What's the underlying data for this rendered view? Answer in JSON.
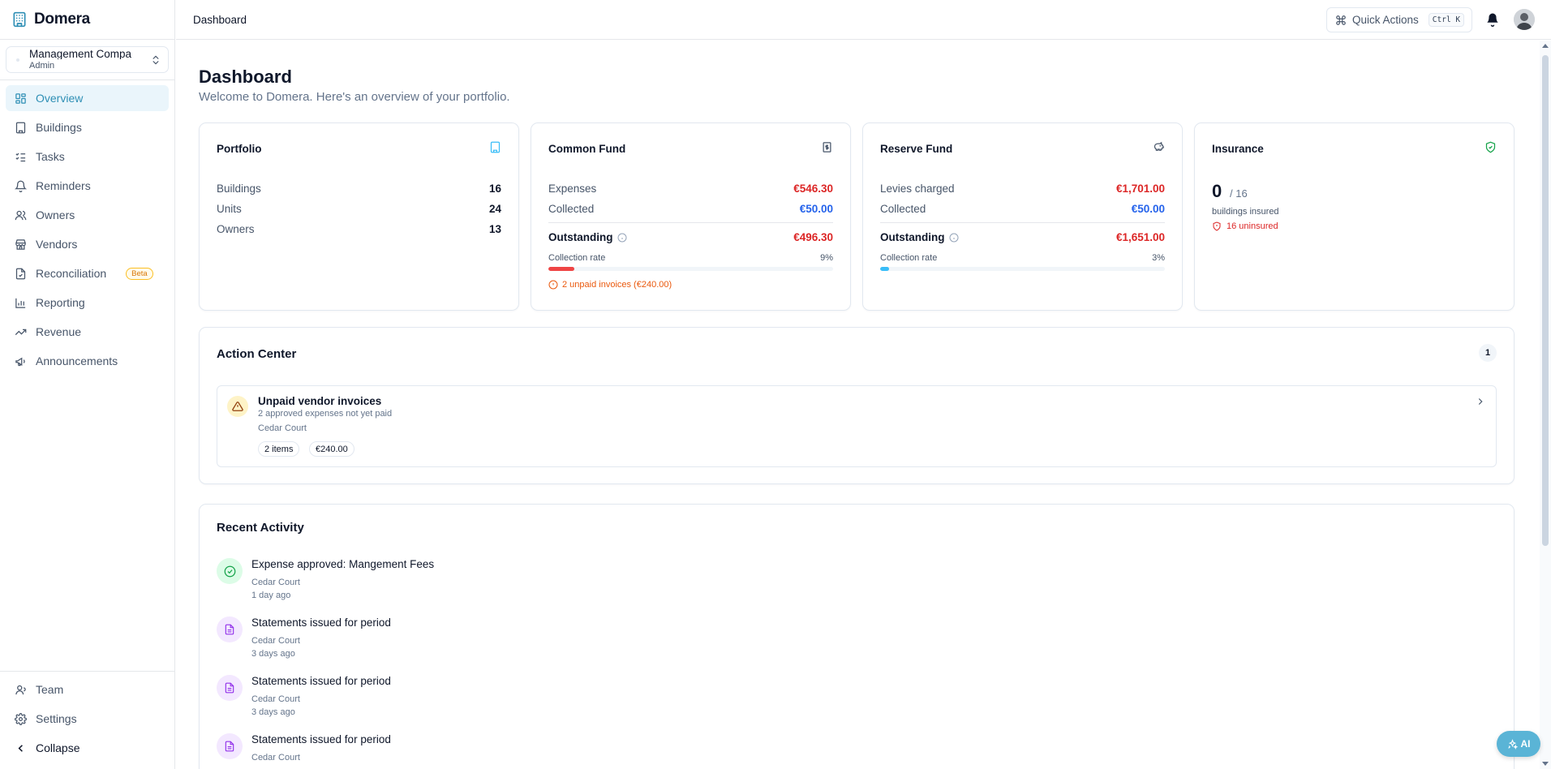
{
  "brand": {
    "name": "Domera",
    "icon": "building-icon",
    "color": "#2f8fb5"
  },
  "org": {
    "name": "Management Compa",
    "role": "Admin"
  },
  "nav": [
    {
      "label": "Overview",
      "icon": "grid-icon",
      "active": true
    },
    {
      "label": "Buildings",
      "icon": "building-icon"
    },
    {
      "label": "Tasks",
      "icon": "list-checks-icon"
    },
    {
      "label": "Reminders",
      "icon": "bell-icon"
    },
    {
      "label": "Owners",
      "icon": "users-icon"
    },
    {
      "label": "Vendors",
      "icon": "store-icon"
    },
    {
      "label": "Reconciliation",
      "icon": "file-check-icon",
      "badge": "Beta"
    },
    {
      "label": "Reporting",
      "icon": "bar-chart-icon"
    },
    {
      "label": "Revenue",
      "icon": "trending-up-icon"
    },
    {
      "label": "Announcements",
      "icon": "megaphone-icon"
    }
  ],
  "nav_bottom": [
    {
      "label": "Team",
      "icon": "user-icon"
    },
    {
      "label": "Settings",
      "icon": "gear-icon"
    },
    {
      "label": "Collapse",
      "icon": "chevron-left-icon"
    }
  ],
  "topbar": {
    "breadcrumb": "Dashboard",
    "quick_actions": "Quick Actions",
    "shortcut": "Ctrl K"
  },
  "page": {
    "title": "Dashboard",
    "subtitle": "Welcome to Domera. Here's an overview of your portfolio."
  },
  "portfolio": {
    "title": "Portfolio",
    "rows": [
      {
        "label": "Buildings",
        "value": "16"
      },
      {
        "label": "Units",
        "value": "24"
      },
      {
        "label": "Owners",
        "value": "13"
      }
    ]
  },
  "common_fund": {
    "title": "Common Fund",
    "expenses_label": "Expenses",
    "expenses": "€546.30",
    "collected_label": "Collected",
    "collected": "€50.00",
    "outstanding_label": "Outstanding",
    "outstanding": "€496.30",
    "rate_label": "Collection rate",
    "rate": "9%",
    "rate_value": 0.09,
    "bar_color": "#ef4444",
    "warning": "2 unpaid invoices (€240.00)"
  },
  "reserve_fund": {
    "title": "Reserve Fund",
    "levies_label": "Levies charged",
    "levies": "€1,701.00",
    "collected_label": "Collected",
    "collected": "€50.00",
    "outstanding_label": "Outstanding",
    "outstanding": "€1,651.00",
    "rate_label": "Collection rate",
    "rate": "3%",
    "rate_value": 0.03,
    "bar_color": "#38bdf8"
  },
  "insurance": {
    "title": "Insurance",
    "insured": "0",
    "of_total": "/ 16",
    "label": "buildings insured",
    "warning": "16 uninsured"
  },
  "action_center": {
    "title": "Action Center",
    "count": "1",
    "items": [
      {
        "title": "Unpaid vendor invoices",
        "description": "2 approved expenses not yet paid",
        "building": "Cedar Court",
        "items_pill": "2 items",
        "amount_pill": "€240.00"
      }
    ]
  },
  "recent_activity": {
    "title": "Recent Activity",
    "items": [
      {
        "title": "Expense approved: Mangement Fees",
        "building": "Cedar Court",
        "time": "1 day ago",
        "icon": "check-circle-icon"
      },
      {
        "title": "Statements issued for period",
        "building": "Cedar Court",
        "time": "3 days ago",
        "icon": "document-icon"
      },
      {
        "title": "Statements issued for period",
        "building": "Cedar Court",
        "time": "3 days ago",
        "icon": "document-icon"
      },
      {
        "title": "Statements issued for period",
        "building": "Cedar Court",
        "time": "",
        "icon": "document-icon"
      }
    ]
  },
  "ai_button": {
    "label": "AI"
  }
}
